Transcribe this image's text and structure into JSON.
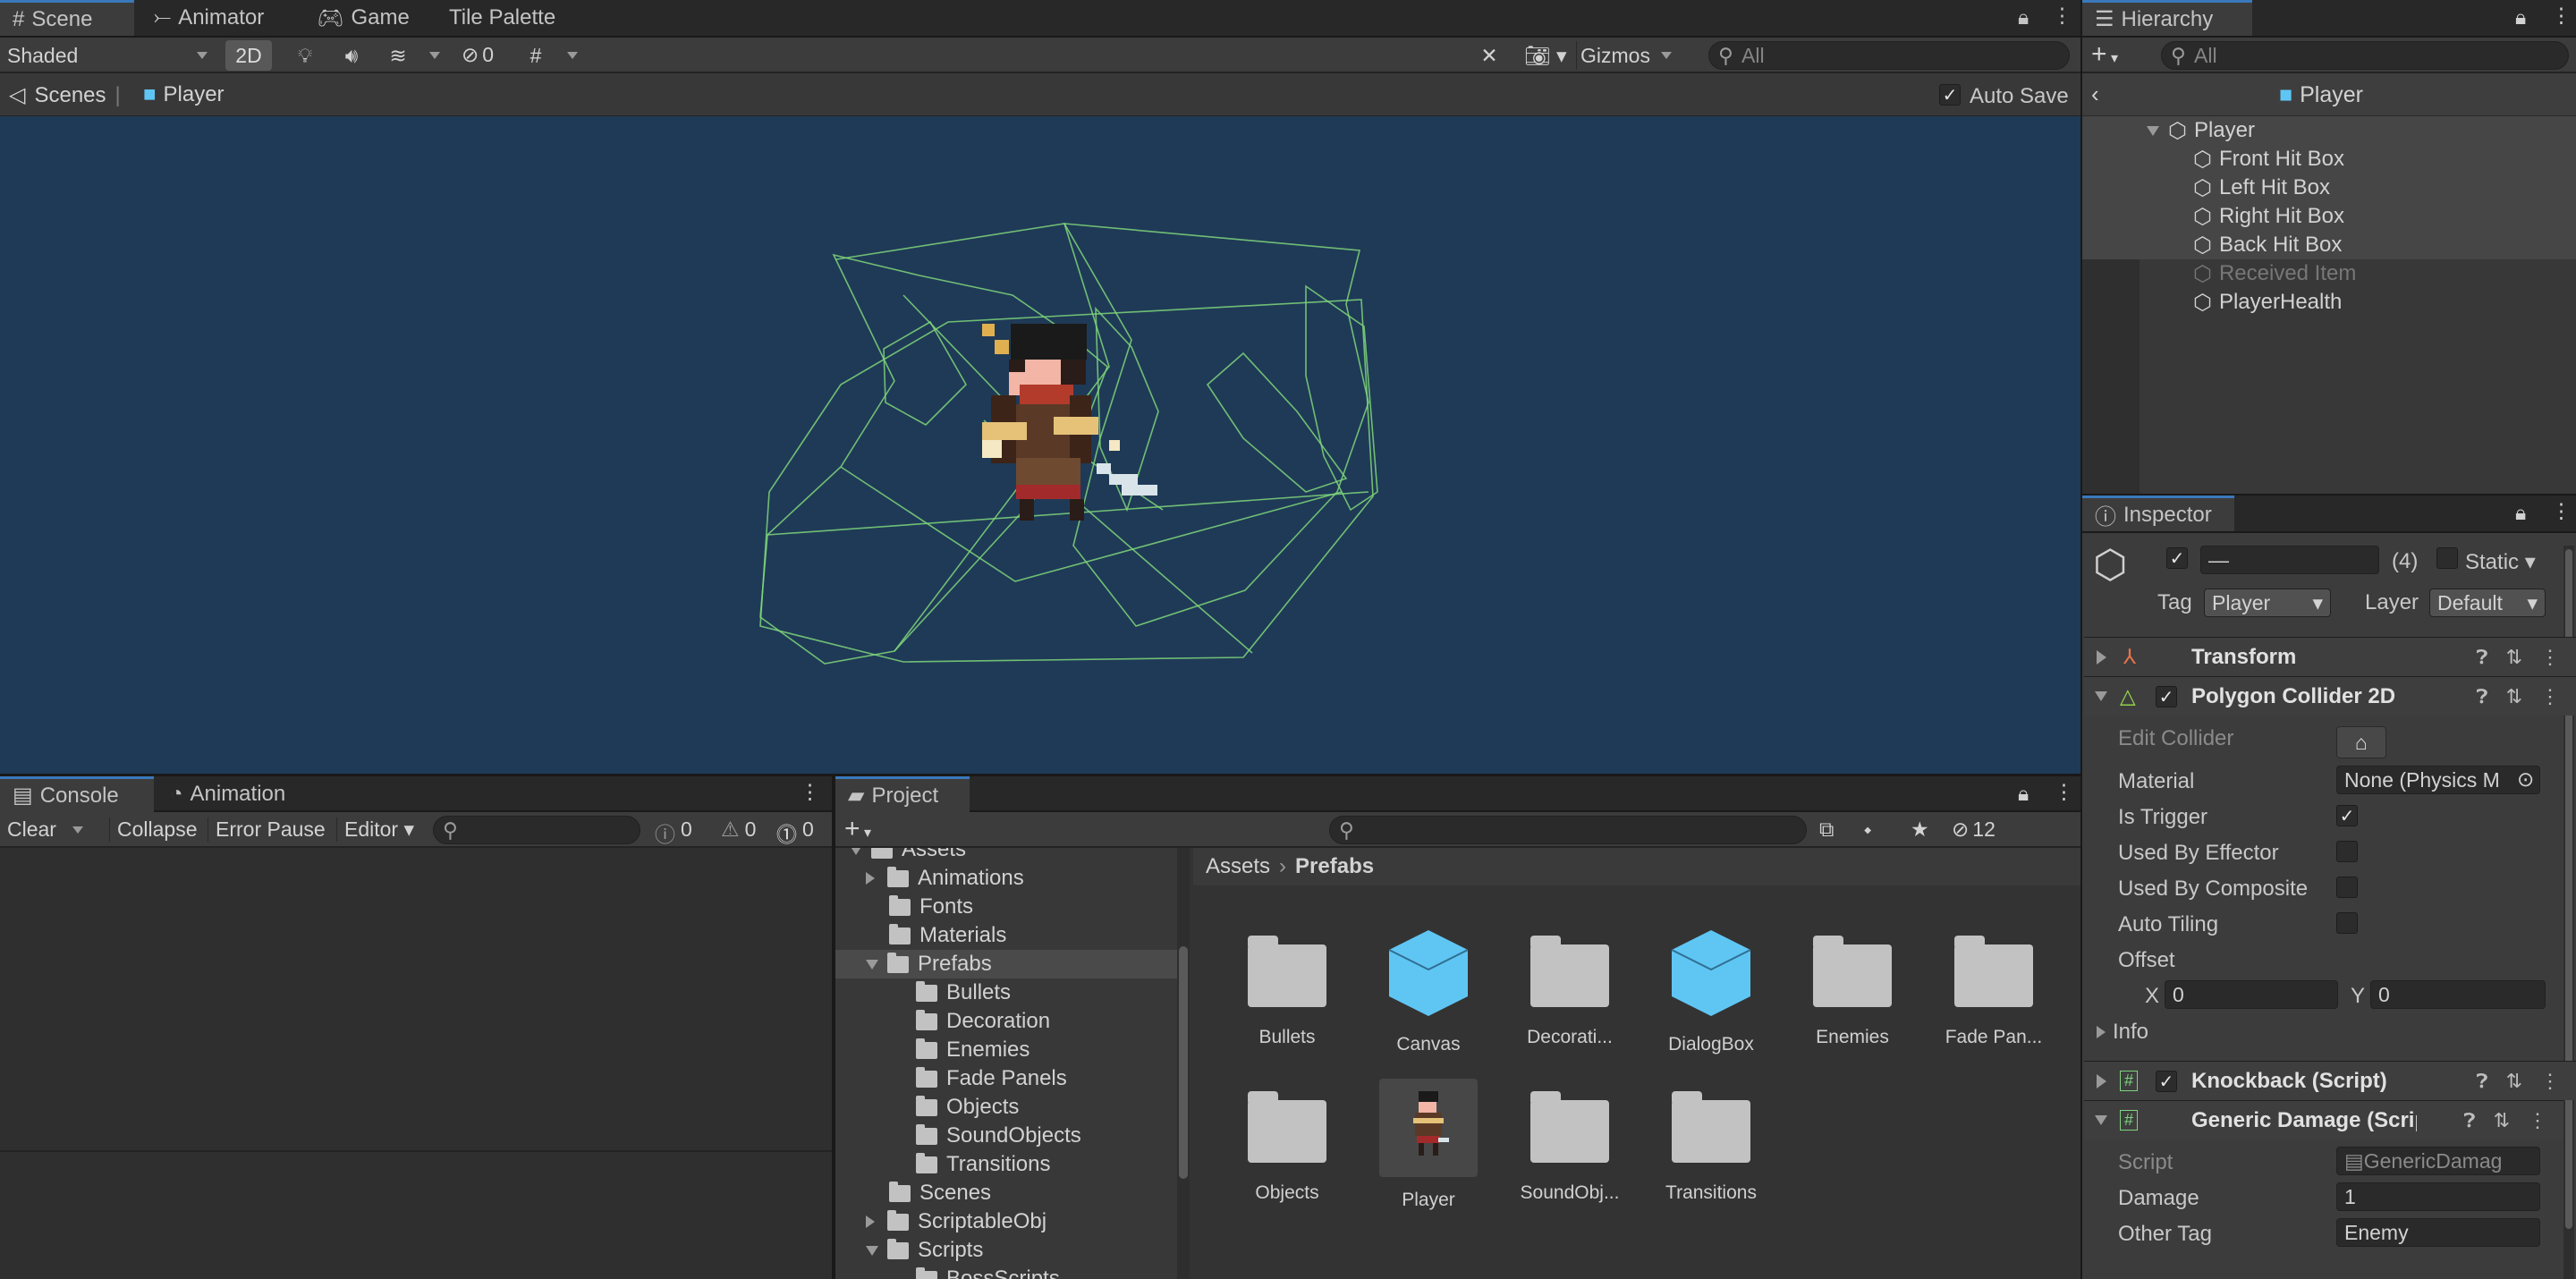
{
  "scene_tabs": [
    "Scene",
    "Animator",
    "Game",
    "Tile Palette"
  ],
  "scene_toolbar": {
    "shading": "Shaded",
    "mode_2d": "2D",
    "hidden_count": "0",
    "gizmos": "Gizmos",
    "search_placeholder": "All"
  },
  "breadcrumb": {
    "root": "Scenes",
    "current": "Player",
    "auto_save": "Auto Save"
  },
  "hierarchy": {
    "tab": "Hierarchy",
    "search_placeholder": "All",
    "header": "Player",
    "items": [
      "Player",
      "Front Hit Box",
      "Left Hit Box",
      "Right Hit Box",
      "Back Hit Box",
      "Received Item",
      "PlayerHealth"
    ]
  },
  "inspector": {
    "tab": "Inspector",
    "name_value": "—",
    "count": "(4)",
    "static_label": "Static",
    "tag_label": "Tag",
    "tag_value": "Player",
    "layer_label": "Layer",
    "layer_value": "Default",
    "components": {
      "transform": "Transform",
      "polygon": "Polygon Collider 2D",
      "knockback": "Knockback (Script)",
      "generic_damage": "Generic Damage (Script)"
    },
    "polygon_fields": {
      "edit_collider": "Edit Collider",
      "material": "Material",
      "material_value": "None (Physics M",
      "is_trigger": "Is Trigger",
      "used_by_effector": "Used By Effector",
      "used_by_composite": "Used By Composite",
      "auto_tiling": "Auto Tiling",
      "offset": "Offset",
      "x_label": "X",
      "x_value": "0",
      "y_label": "Y",
      "y_value": "0",
      "info": "Info"
    },
    "damage_fields": {
      "script": "Script",
      "script_value": "GenericDamag",
      "damage": "Damage",
      "damage_value": "1",
      "other_tag": "Other Tag",
      "other_tag_value": "Enemy"
    }
  },
  "console": {
    "tabs": [
      "Console",
      "Animation"
    ],
    "buttons": [
      "Clear",
      "Collapse",
      "Error Pause",
      "Editor"
    ],
    "info_count": "0",
    "warn_count": "0",
    "error_count": "0"
  },
  "project": {
    "tab": "Project",
    "hidden_count": "12",
    "breadcrumb": [
      "Assets",
      "Prefabs"
    ],
    "tree": [
      "Assets",
      "Animations",
      "Fonts",
      "Materials",
      "Prefabs",
      "Bullets",
      "Decoration",
      "Enemies",
      "Fade Panels",
      "Objects",
      "SoundObjects",
      "Transitions",
      "Scenes",
      "ScriptableObj",
      "Scripts",
      "BossScripts"
    ],
    "assets": [
      "Bullets",
      "Canvas",
      "Decorati...",
      "DialogBox",
      "Enemies",
      "Fade Pan...",
      "Objects",
      "Player",
      "SoundObj...",
      "Transitions"
    ]
  },
  "colors": {
    "scene_bg": "#1f3a57",
    "accent": "#3a79bb",
    "prefab_blue": "#5fc6f4",
    "collider": "#7fd67a"
  }
}
